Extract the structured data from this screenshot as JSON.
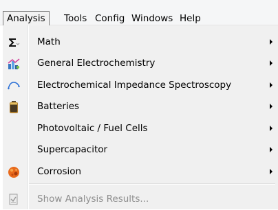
{
  "menubar": {
    "items": [
      {
        "label": "Analysis",
        "active": true
      },
      {
        "label": "Tools"
      },
      {
        "label": "Config"
      },
      {
        "label": "Windows"
      },
      {
        "label": "Help"
      }
    ]
  },
  "menu": {
    "items": [
      {
        "label": "Math",
        "icon": "sigma-icon",
        "submenu": true
      },
      {
        "label": "General Electrochemistry",
        "icon": "chart-icon",
        "submenu": true
      },
      {
        "label": "Electrochemical Impedance Spectroscopy",
        "icon": "impedance-arc-icon",
        "submenu": true
      },
      {
        "label": "Batteries",
        "icon": "battery-icon",
        "submenu": true
      },
      {
        "label": "Photovoltaic / Fuel Cells",
        "icon": "",
        "submenu": true
      },
      {
        "label": "Supercapacitor",
        "icon": "",
        "submenu": true
      },
      {
        "label": "Corrosion",
        "icon": "corrosion-icon",
        "submenu": true
      }
    ],
    "footer_item": {
      "label": "Show Analysis Results...",
      "icon": "results-icon",
      "disabled": true
    }
  },
  "colors": {
    "menu_background": "#f0f0f0",
    "disabled_text": "#8d8d8d",
    "active_border": "#7a7a7a"
  }
}
